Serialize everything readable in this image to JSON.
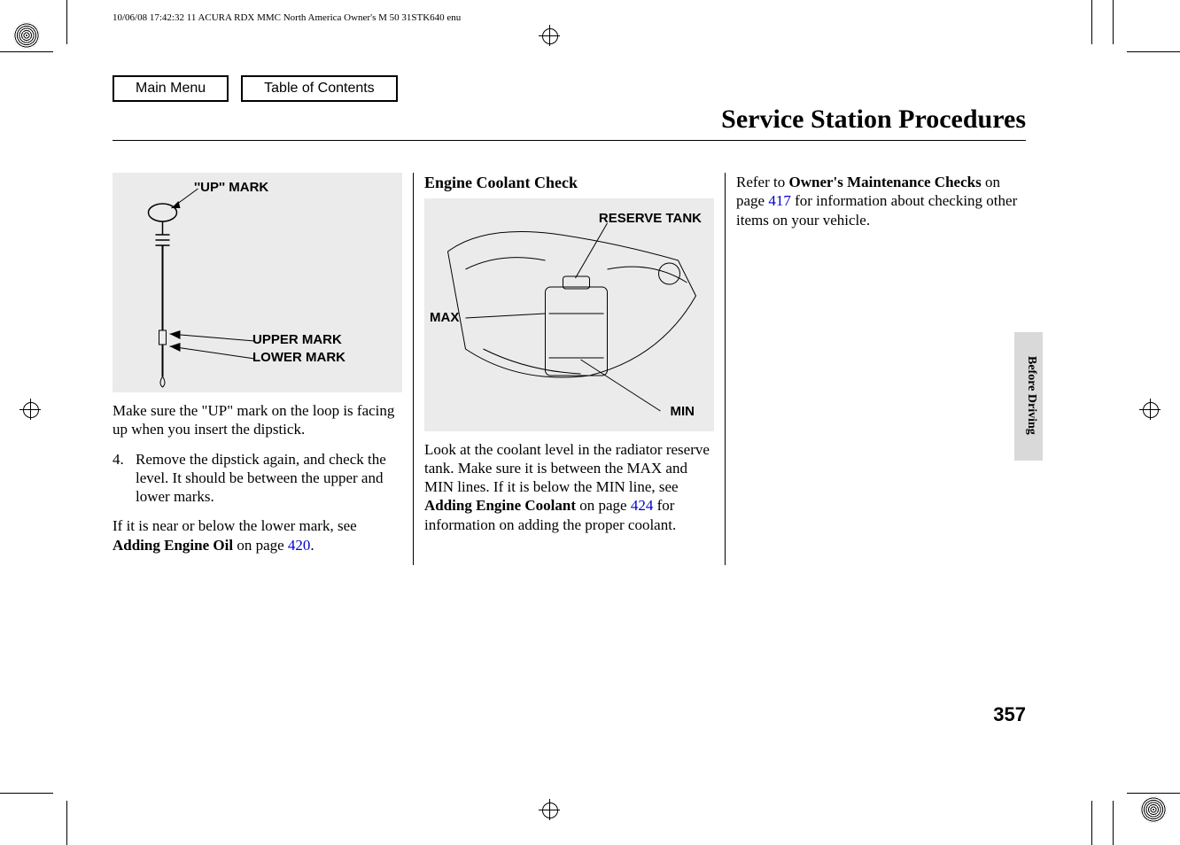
{
  "meta": {
    "header_line": "10/06/08 17:42:32   11 ACURA RDX MMC North America Owner's M 50 31STK640 enu"
  },
  "nav": {
    "main_menu": "Main Menu",
    "toc": "Table of Contents"
  },
  "title": "Service Station Procedures",
  "side_section": "Before Driving",
  "page_number": "357",
  "col1": {
    "fig": {
      "up_mark": "''UP'' MARK",
      "upper_mark": "UPPER MARK",
      "lower_mark": "LOWER MARK"
    },
    "p1": "Make sure the \"UP\" mark on the loop is facing up when you insert the dipstick.",
    "item4_num": "4.",
    "item4_text": "Remove the dipstick again, and check the level. It should be between the upper and lower marks.",
    "p3_a": "If it is near or below the lower mark, see ",
    "p3_b": "Adding Engine Oil",
    "p3_c": " on page ",
    "p3_link": "420",
    "p3_d": "."
  },
  "col2": {
    "heading": "Engine Coolant Check",
    "fig": {
      "reserve_tank": "RESERVE TANK",
      "max": "MAX",
      "min": "MIN"
    },
    "p1_a": "Look at the coolant level in the radiator reserve tank. Make sure it is between the MAX and MIN lines. If it is below the MIN line, see ",
    "p1_b": "Adding Engine Coolant",
    "p1_c": " on page ",
    "p1_link": "424",
    "p1_d": " for information on adding the proper coolant."
  },
  "col3": {
    "p1_a": "Refer to ",
    "p1_b": "Owner's Maintenance Checks",
    "p1_c": " on page ",
    "p1_link": "417",
    "p1_d": " for information about checking other items on your vehicle."
  }
}
